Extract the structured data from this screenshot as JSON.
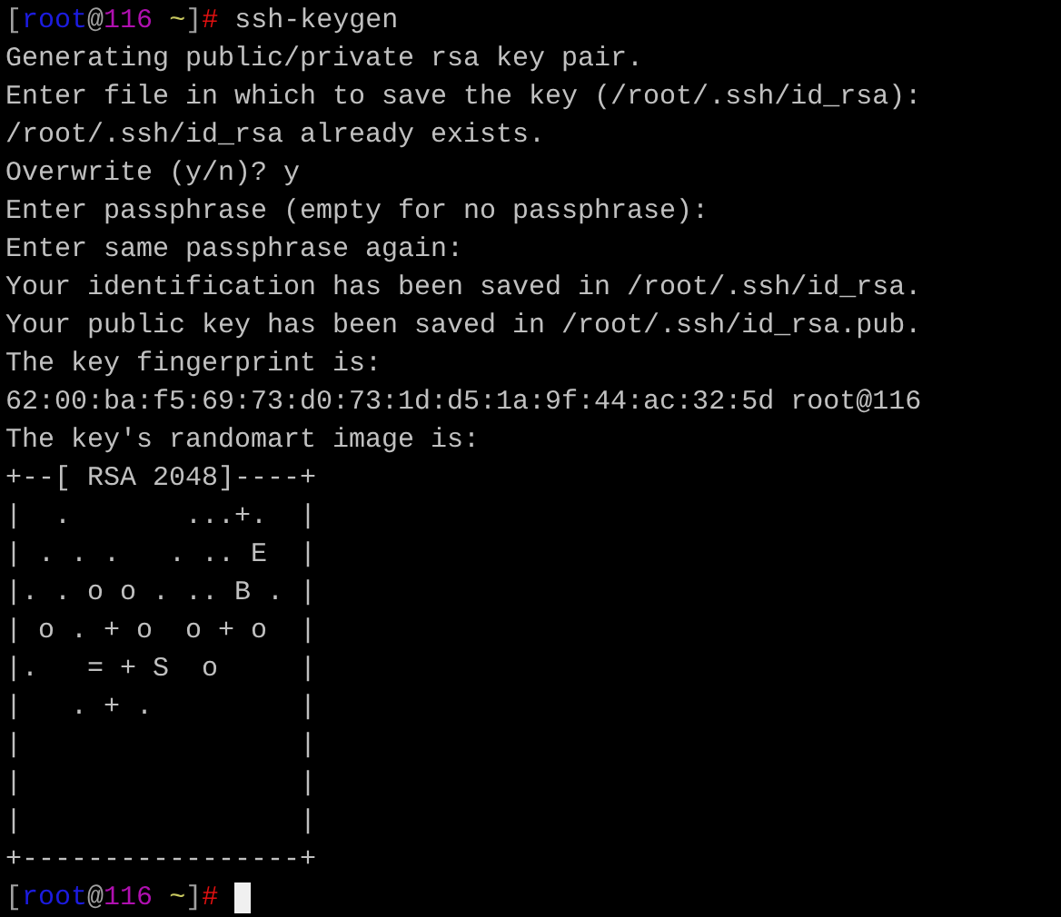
{
  "terminal": {
    "lines": [
      {
        "kind": "prompt",
        "segments": [
          {
            "text": "[",
            "color": "#a0a0a0"
          },
          {
            "text": "root",
            "color": "#1c1ce0"
          },
          {
            "text": "@",
            "color": "#a0a0a0"
          },
          {
            "text": "116",
            "color": "#b010b0"
          },
          {
            "text": " ~",
            "color": "#c8c860"
          },
          {
            "text": "]",
            "color": "#a0a0a0"
          },
          {
            "text": "#",
            "color": "#e01010"
          }
        ],
        "command": "ssh-keygen",
        "cursor": false
      },
      {
        "kind": "output",
        "text": "Generating public/private rsa key pair."
      },
      {
        "kind": "output",
        "text": "Enter file in which to save the key (/root/.ssh/id_rsa):"
      },
      {
        "kind": "output",
        "text": "/root/.ssh/id_rsa already exists."
      },
      {
        "kind": "output",
        "text": "Overwrite (y/n)? y"
      },
      {
        "kind": "output",
        "text": "Enter passphrase (empty for no passphrase):"
      },
      {
        "kind": "output",
        "text": "Enter same passphrase again:"
      },
      {
        "kind": "output",
        "text": "Your identification has been saved in /root/.ssh/id_rsa."
      },
      {
        "kind": "output",
        "text": "Your public key has been saved in /root/.ssh/id_rsa.pub."
      },
      {
        "kind": "output",
        "text": "The key fingerprint is:"
      },
      {
        "kind": "output",
        "text": "62:00:ba:f5:69:73:d0:73:1d:d5:1a:9f:44:ac:32:5d root@116"
      },
      {
        "kind": "output",
        "text": "The key's randomart image is:"
      },
      {
        "kind": "output",
        "text": "+--[ RSA 2048]----+"
      },
      {
        "kind": "output",
        "text": "|  .       ...+.  |"
      },
      {
        "kind": "output",
        "text": "| . . .   . .. E  |"
      },
      {
        "kind": "output",
        "text": "|. . o o . .. B . |"
      },
      {
        "kind": "output",
        "text": "| o . + o  o + o  |"
      },
      {
        "kind": "output",
        "text": "|.   = + S  o     |"
      },
      {
        "kind": "output",
        "text": "|   . + .         |"
      },
      {
        "kind": "output",
        "text": "|                 |"
      },
      {
        "kind": "output",
        "text": "|                 |"
      },
      {
        "kind": "output",
        "text": "|                 |"
      },
      {
        "kind": "output",
        "text": "+-----------------+"
      },
      {
        "kind": "prompt",
        "segments": [
          {
            "text": "[",
            "color": "#a0a0a0"
          },
          {
            "text": "root",
            "color": "#1c1ce0"
          },
          {
            "text": "@",
            "color": "#a0a0a0"
          },
          {
            "text": "116",
            "color": "#b010b0"
          },
          {
            "text": " ~",
            "color": "#c8c860"
          },
          {
            "text": "]",
            "color": "#a0a0a0"
          },
          {
            "text": "#",
            "color": "#e01010"
          }
        ],
        "cursor": true
      }
    ]
  }
}
